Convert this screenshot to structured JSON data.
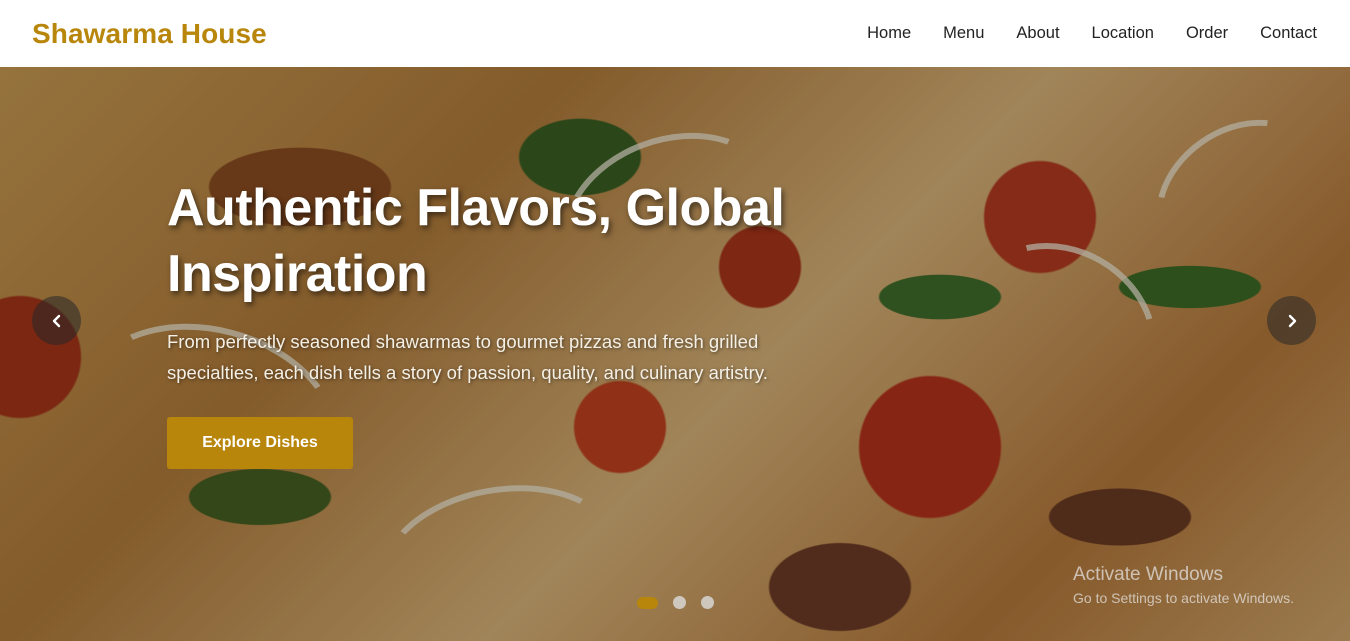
{
  "header": {
    "brand": "Shawarma House",
    "nav": [
      {
        "label": "Home"
      },
      {
        "label": "Menu"
      },
      {
        "label": "About"
      },
      {
        "label": "Location"
      },
      {
        "label": "Order"
      },
      {
        "label": "Contact"
      }
    ]
  },
  "hero": {
    "title_line1": "Authentic Flavors, Global",
    "title_line2": "Inspiration",
    "subtitle_line1": "From perfectly seasoned shawarmas to gourmet pizzas and fresh grilled",
    "subtitle_line2": "specialties, each dish tells a story of passion, quality, and culinary artistry.",
    "cta_label": "Explore Dishes",
    "prev_icon": "‹",
    "next_icon": "›",
    "slides": {
      "count": 3,
      "active_index": 0
    }
  },
  "watermark": {
    "title": "Activate Windows",
    "subtitle": "Go to Settings to activate Windows."
  },
  "colors": {
    "brand": "#b8860b",
    "nav_text": "#222222",
    "hero_text": "#ffffff"
  }
}
